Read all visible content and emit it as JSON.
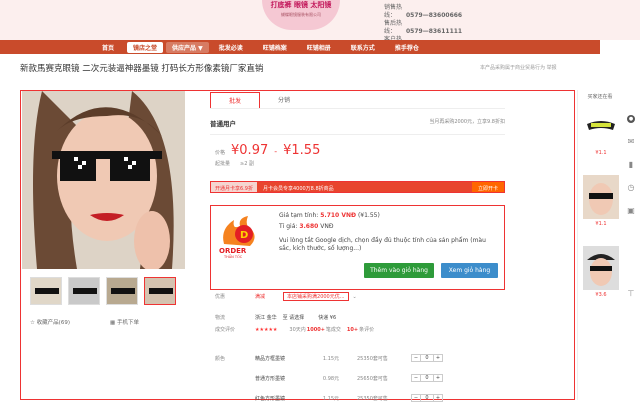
{
  "header": {
    "logo_title": "打底裤  眼镜  太阳镜",
    "logo_sub": "蝴蝶眼镜服装有限公司",
    "contacts": [
      {
        "label": "销售热线：",
        "value": "0579—83600666"
      },
      {
        "label": "售后热线：",
        "value": "0579—83611111"
      },
      {
        "label": "客户热线：",
        "value": "13958936685"
      }
    ]
  },
  "nav": {
    "items": [
      {
        "label": "首页",
        "style": ""
      },
      {
        "label": "镜店之堂",
        "style": "hl"
      },
      {
        "label": "供应产品 ▼",
        "style": "hl2"
      },
      {
        "label": "批发必读",
        "style": ""
      },
      {
        "label": "旺铺档案",
        "style": ""
      },
      {
        "label": "旺铺相册",
        "style": ""
      },
      {
        "label": "联系方式",
        "style": ""
      },
      {
        "label": "推手荐仓",
        "style": ""
      }
    ]
  },
  "product": {
    "title": "新款馬赛克眼镜 二次元装逼神器墨镜 打码长方形像素镜厂家直销",
    "title_right": "本产品采购属于商业贸易行为    举报",
    "tabs": [
      "批发",
      "分销"
    ],
    "user_level": "普通用户",
    "purchase_note": "当月再采购2000元，立享9.8折扣",
    "price_label": "价格",
    "price_low": "¥0.97",
    "price_sep": "-",
    "price_high": "¥1.55",
    "stock_label": "起批量",
    "stock_value": "≥2 副",
    "promo_a": "开通月卡享6.9折",
    "promo_b": "月卡会员专享4000万8.8折商品",
    "promo_c": "立即开卡",
    "collect": "☆ 收藏产品(69)",
    "mobile": "手机下单"
  },
  "extension": {
    "logo_text": "ORDER",
    "logo_sub": "THẦN TỐC",
    "est_label": "Giá tạm tính:",
    "est_value": "5.710 VNĐ",
    "est_orig": "(¥1.55)",
    "rate_label": "Tỉ giá:",
    "rate_value": "3.680",
    "rate_unit": "VNĐ",
    "instruction": "Vui lòng tắt Google dịch, chọn đầy đủ thuộc tính của sản phẩm (màu sắc, kích thước, số lượng...)",
    "add_cart": "Thêm vào giỏ hàng",
    "view_cart": "Xem giỏ hàng"
  },
  "details": {
    "promo_label": "优惠",
    "promo_tag": "满减",
    "promo_text": "本店铺采购满2000元优...",
    "ship_label": "物流",
    "ship_from": "浙江 金华",
    "ship_to": "至 请选择",
    "ship_cost": "快递 ¥6",
    "review_label": "成交评价",
    "review_stars": "★★★★★",
    "review_deals": "30天内",
    "review_deals_num": "1000+",
    "review_deals_suffix": "笔成交",
    "review_count": "10+",
    "review_count_suffix": "条评价"
  },
  "variants": {
    "color_label": "颜色",
    "rows": [
      {
        "name": "精品方框墨镜",
        "price": "1.15元",
        "stock": "25350套可售",
        "qty": "0"
      },
      {
        "name": "普通方形墨镜",
        "price": "0.98元",
        "stock": "25650套可售",
        "qty": "0"
      },
      {
        "name": "红色方形墨镜",
        "price": "1.15元",
        "stock": "25350套可售",
        "qty": "0"
      }
    ]
  },
  "right_panel": {
    "title": "买家还在看",
    "items": [
      {
        "price": "¥1.1"
      },
      {
        "price": "¥1.1"
      },
      {
        "price": "¥3.6"
      }
    ]
  }
}
